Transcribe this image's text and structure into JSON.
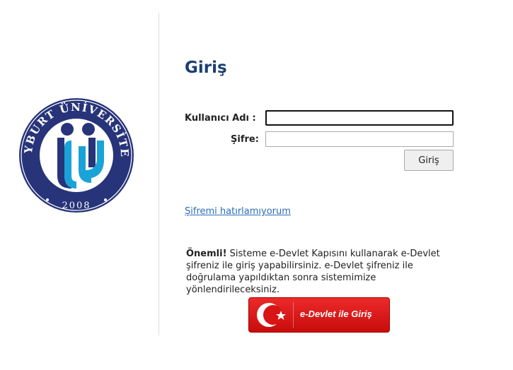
{
  "logo": {
    "ring_text": "BAYBURT ÜNİVERSİTESİ",
    "year": "2008",
    "colors": {
      "navy": "#27347a",
      "cyan": "#1aa3d8"
    }
  },
  "login": {
    "title": "Giriş",
    "username_label": "Kullanıcı Adı :",
    "username_value": "",
    "password_label": "Şifre:",
    "password_value": "",
    "submit_label": "Giriş",
    "forgot_link": "Şifremi hatırlamıyorum"
  },
  "notice": {
    "strong": "Önemli!",
    "text": " Sisteme e-Devlet Kapısını kullanarak e-Devlet şifreniz ile giriş yapabilirsiniz. e-Devlet şifreniz ile doğrulama yapıldıktan sonra sistemimize yönlendirileceksiniz."
  },
  "edevlet": {
    "label": "e-Devlet ile Giriş",
    "color": "#e21b1b"
  }
}
